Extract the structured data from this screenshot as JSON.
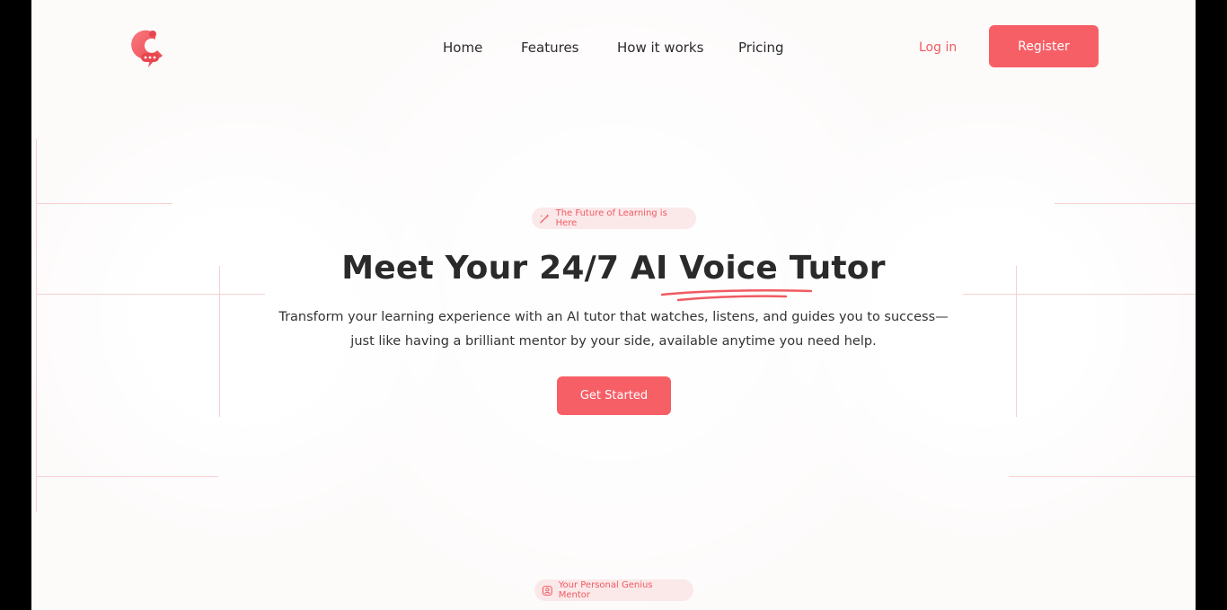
{
  "header": {
    "logo_alt": "C",
    "nav": [
      {
        "label": "Home"
      },
      {
        "label": "Features"
      },
      {
        "label": "How it works"
      },
      {
        "label": "Pricing"
      }
    ],
    "login_label": "Log in",
    "register_label": "Register"
  },
  "hero": {
    "badge": "The Future of Learning is Here",
    "title": "Meet Your 24/7 AI Voice Tutor",
    "subtitle_line1": "Transform your learning experience with an AI tutor that watches, listens, and guides you to success—",
    "subtitle_line2": "just like having a brilliant mentor by your side, available anytime you need help.",
    "cta_label": "Get Started"
  },
  "next_section": {
    "badge": "Your Personal Genius Mentor"
  },
  "colors": {
    "accent": "#f75f66",
    "accent_text": "#f15b62",
    "badge_bg": "#fbe8e9",
    "page_bg": "#fdfafa",
    "grid_line": "#f6cfd1"
  },
  "icons": {
    "logo": "chat-bubble-c-logo",
    "badge1": "magic-wand-icon",
    "badge2": "user-badge-icon"
  }
}
